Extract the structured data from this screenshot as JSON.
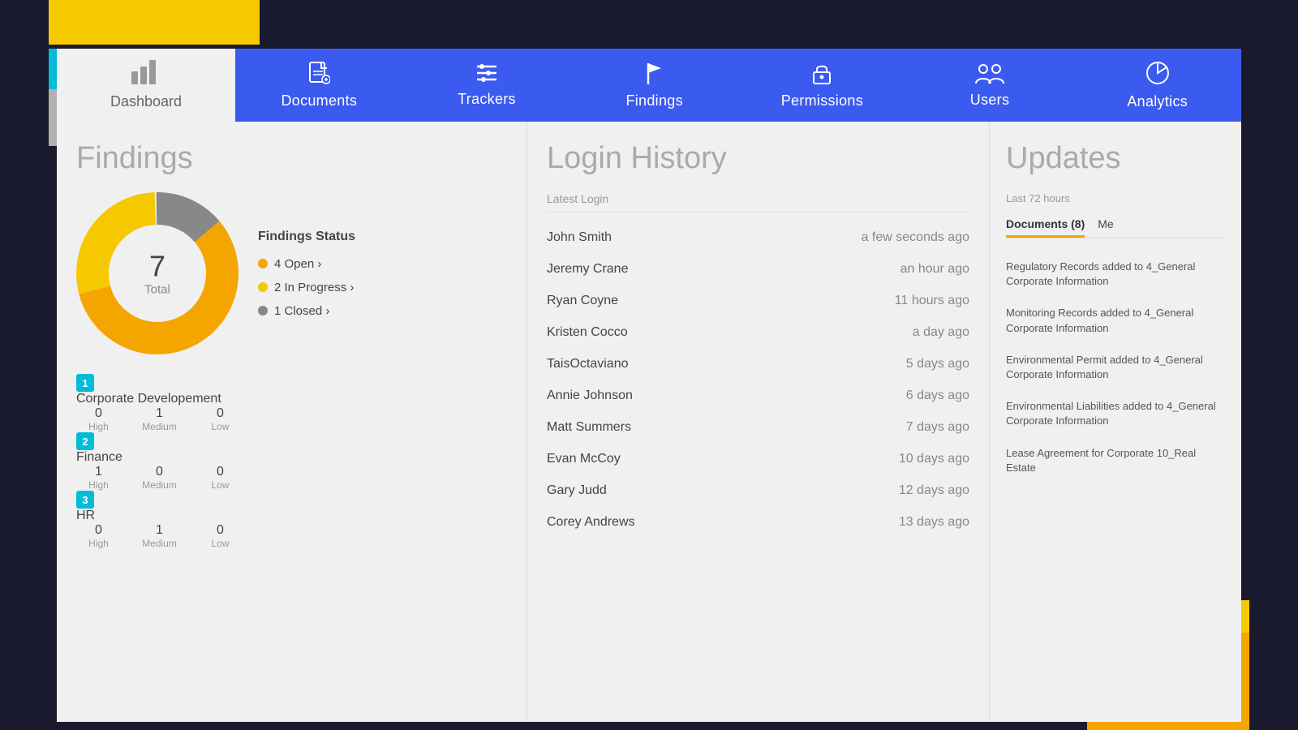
{
  "decorative": {
    "note": "decorative corner blocks"
  },
  "navbar": {
    "dashboard_label": "Dashboard",
    "items": [
      {
        "id": "documents",
        "label": "Documents",
        "icon": "📄"
      },
      {
        "id": "trackers",
        "label": "Trackers",
        "icon": "☰"
      },
      {
        "id": "findings",
        "label": "Findings",
        "icon": "🚩"
      },
      {
        "id": "permissions",
        "label": "Permissions",
        "icon": "🔒"
      },
      {
        "id": "users",
        "label": "Users",
        "icon": "👥"
      },
      {
        "id": "analytics",
        "label": "Analytics",
        "icon": "📊"
      }
    ]
  },
  "findings": {
    "title": "Findings",
    "donut": {
      "total": "7",
      "total_label": "Total"
    },
    "legend": {
      "title": "Findings Status",
      "items": [
        {
          "label": "4 Open ›",
          "type": "open"
        },
        {
          "label": "2 In Progress ›",
          "type": "inprogress"
        },
        {
          "label": "1 Closed ›",
          "type": "closed"
        }
      ]
    },
    "rows": [
      {
        "num": "1",
        "name": "Corporate Developement",
        "high": "0",
        "medium": "1",
        "low": "0"
      },
      {
        "num": "2",
        "name": "Finance",
        "high": "1",
        "medium": "0",
        "low": "0"
      },
      {
        "num": "3",
        "name": "HR",
        "high": "0",
        "medium": "1",
        "low": "0"
      }
    ]
  },
  "login_history": {
    "title": "Login History",
    "subtitle": "Latest Login",
    "entries": [
      {
        "name": "John Smith",
        "time": "a few seconds ago"
      },
      {
        "name": "Jeremy Crane",
        "time": "an hour ago"
      },
      {
        "name": "Ryan Coyne",
        "time": "11 hours ago"
      },
      {
        "name": "Kristen Cocco",
        "time": "a day ago"
      },
      {
        "name": "TaisOctaviano",
        "time": "5 days ago"
      },
      {
        "name": "Annie Johnson",
        "time": "6 days ago"
      },
      {
        "name": "Matt Summers",
        "time": "7 days ago"
      },
      {
        "name": "Evan McCoy",
        "time": "10 days ago"
      },
      {
        "name": "Gary Judd",
        "time": "12 days ago"
      },
      {
        "name": "Corey Andrews",
        "time": "13 days ago"
      }
    ]
  },
  "updates": {
    "title": "Updates",
    "subtitle": "Last 72 hours",
    "tabs": [
      {
        "label": "Documents (8)",
        "active": true
      },
      {
        "label": "Me",
        "active": false
      }
    ],
    "items": [
      {
        "text": "Regulatory Records added to 4_General Corporate Information"
      },
      {
        "text": "Monitoring Records added to 4_General Corporate Information"
      },
      {
        "text": "Environmental Permit added to 4_General Corporate Information"
      },
      {
        "text": "Environmental Liabilities added to 4_General Corporate Information"
      },
      {
        "text": "Lease Agreement for Corporate 10_Real Estate"
      }
    ]
  }
}
